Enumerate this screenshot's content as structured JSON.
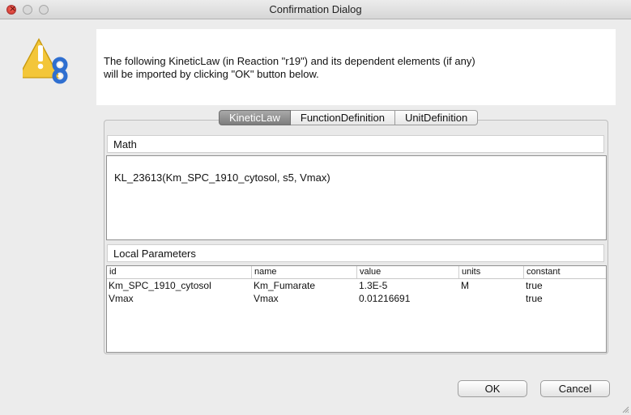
{
  "window": {
    "title": "Confirmation Dialog",
    "controls": [
      "close",
      "minimize",
      "zoom"
    ]
  },
  "icon": {
    "name": "warning-icon",
    "colors": {
      "triangle": "#f3c63a",
      "logo": "#2f6fd0"
    }
  },
  "message": {
    "line1": "The following KineticLaw (in Reaction \"r19\") and its dependent elements (if any)",
    "line2": "will be imported by clicking \"OK\" button below."
  },
  "tabs": [
    {
      "label": "KineticLaw",
      "active": true
    },
    {
      "label": "FunctionDefinition",
      "active": false
    },
    {
      "label": "UnitDefinition",
      "active": false
    }
  ],
  "math": {
    "label": "Math",
    "expression": "KL_23613(Km_SPC_1910_cytosol, s5, Vmax)"
  },
  "local_parameters": {
    "label": "Local Parameters",
    "columns": [
      "id",
      "name",
      "value",
      "units",
      "constant"
    ],
    "rows": [
      [
        "Km_SPC_1910_cytosol",
        "Km_Fumarate",
        "1.3E-5",
        "M",
        "true"
      ],
      [
        "Vmax",
        "Vmax",
        "0.01216691",
        "",
        "true"
      ]
    ]
  },
  "buttons": {
    "ok": "OK",
    "cancel": "Cancel"
  },
  "colors": {
    "active_tab": "#8e8e8e",
    "panel_background": "#e9e9e9",
    "window_background": "#ececec"
  }
}
